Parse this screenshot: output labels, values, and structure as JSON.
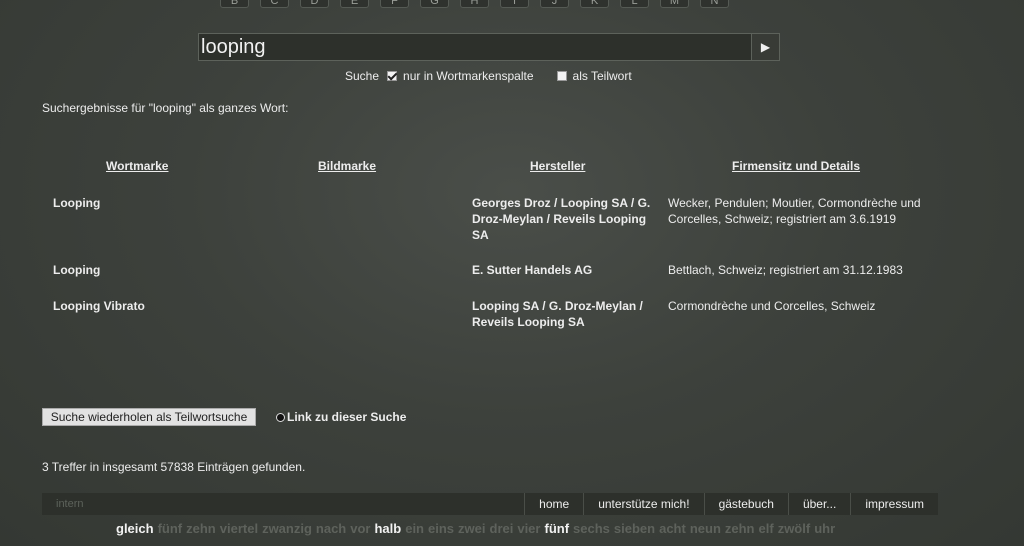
{
  "alphabet": [
    "B",
    "C",
    "D",
    "E",
    "F",
    "G",
    "H",
    "I",
    "J",
    "K",
    "L",
    "M",
    "N"
  ],
  "search": {
    "value": "looping",
    "go_icon": "play-arrow-icon",
    "go_glyph": "▶"
  },
  "options": {
    "suche_label": "Suche",
    "wortmarken_label": "nur in Wortmarkenspalte",
    "wortmarken_checked": true,
    "teilwort_label": "als Teilwort",
    "teilwort_checked": false
  },
  "results": {
    "heading": "Suchergebnisse für \"looping\" als ganzes Wort:",
    "columns": [
      "Wortmarke",
      "Bildmarke",
      "Hersteller",
      "Firmensitz und Details"
    ],
    "rows": [
      {
        "wortmarke": "Looping",
        "bildmarke": "",
        "hersteller": "Georges Droz / Looping SA / G. Droz-Meylan / Reveils Looping SA",
        "details": "Wecker, Pendulen; Moutier, Cormondrèche und Corcelles, Schweiz; registriert am 3.6.1919"
      },
      {
        "wortmarke": "Looping",
        "bildmarke": "",
        "hersteller": "E. Sutter Handels AG",
        "details": "Bettlach, Schweiz; registriert am 31.12.1983"
      },
      {
        "wortmarke": "Looping Vibrato",
        "bildmarke": "",
        "hersteller": "Looping SA / G. Droz-Meylan / Reveils Looping SA",
        "details": "Cormondrèche und Corcelles, Schweiz"
      }
    ]
  },
  "actions": {
    "repeat_button": "Suche wiederholen als Teilwortsuche",
    "link_text": "Link zu dieser Suche",
    "link_icon": "link-circle-icon"
  },
  "count_text": "3 Treffer in insgesamt 57838 Einträgen gefunden.",
  "footer": {
    "intern": "intern",
    "links": [
      "home",
      "unterstütze mich!",
      "gästebuch",
      "über...",
      "impressum"
    ]
  },
  "clock_words": [
    {
      "text": "gleich",
      "lit": true
    },
    {
      "text": "fünf",
      "lit": false
    },
    {
      "text": "zehn",
      "lit": false
    },
    {
      "text": "viertel",
      "lit": false
    },
    {
      "text": "zwanzig",
      "lit": false
    },
    {
      "text": "nach",
      "lit": false
    },
    {
      "text": "vor",
      "lit": false
    },
    {
      "text": "halb",
      "lit": true
    },
    {
      "text": "ein",
      "lit": false
    },
    {
      "text": "eins",
      "lit": false
    },
    {
      "text": "zwei",
      "lit": false
    },
    {
      "text": "drei",
      "lit": false
    },
    {
      "text": "vier",
      "lit": false
    },
    {
      "text": "fünf",
      "lit": true
    },
    {
      "text": "sechs",
      "lit": false
    },
    {
      "text": "sieben",
      "lit": false
    },
    {
      "text": "acht",
      "lit": false
    },
    {
      "text": "neun",
      "lit": false
    },
    {
      "text": "zehn",
      "lit": false
    },
    {
      "text": "elf",
      "lit": false
    },
    {
      "text": "zwölf",
      "lit": false
    },
    {
      "text": "uhr",
      "lit": false
    }
  ]
}
